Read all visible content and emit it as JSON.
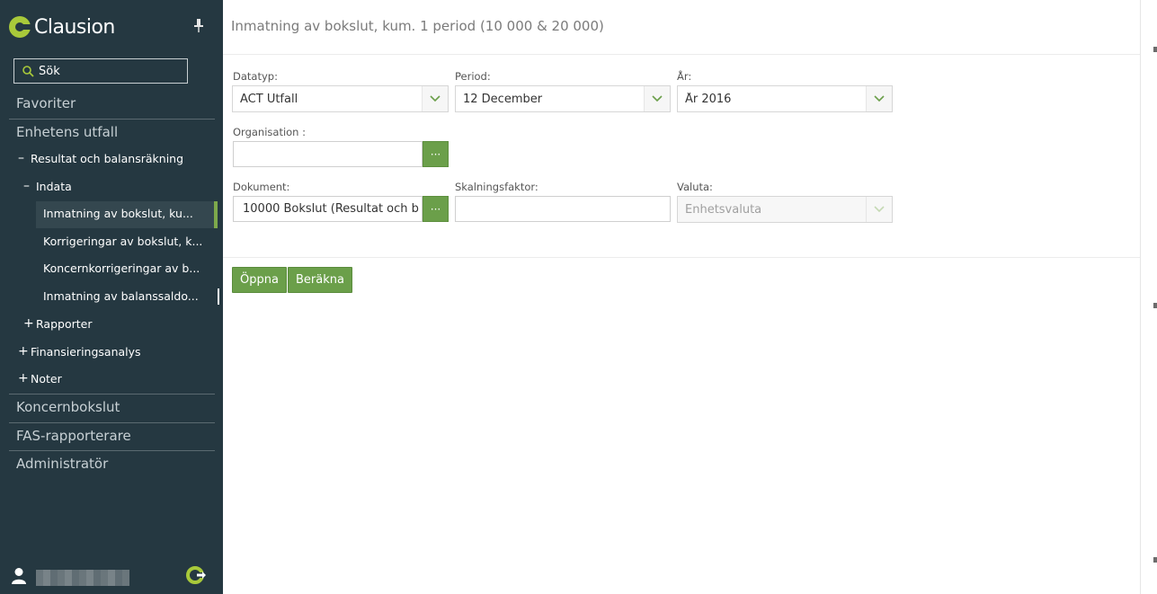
{
  "app": {
    "logo_text": "Clausion",
    "brand_color": "#a8c93a",
    "accent_color": "#6b9f4a"
  },
  "sidebar": {
    "search_placeholder": "Sök",
    "sections": {
      "favoriter": "Favoriter",
      "enhetens_utfall": "Enhetens utfall",
      "koncernbokslut": "Koncernbokslut",
      "fas_rapporterare": "FAS-rapporterare",
      "administrator": "Administratör"
    },
    "tree": {
      "resultat": {
        "sign": "–",
        "label": "Resultat och balansräkning"
      },
      "indata": {
        "sign": "–",
        "label": "Indata"
      },
      "leaves": [
        "Inmatning av bokslut, ku...",
        "Korrigeringar av bokslut, k...",
        "Koncernkorrigeringar av b...",
        "Inmatning av balanssaldo..."
      ],
      "rapporter": {
        "sign": "+",
        "label": "Rapporter"
      },
      "finansieringsanalys": {
        "sign": "+",
        "label": "Finansieringsanalys"
      },
      "noter": {
        "sign": "+",
        "label": "Noter"
      }
    }
  },
  "main": {
    "title": "Inmatning av bokslut, kum. 1 period (10 000 & 20 000)",
    "form": {
      "datatyp": {
        "label": "Datatyp:",
        "value": "ACT Utfall"
      },
      "period": {
        "label": "Period:",
        "value": "12 December"
      },
      "ar": {
        "label": "År:",
        "value": "År 2016"
      },
      "organisation": {
        "label": "Organisation :",
        "value": ""
      },
      "dokument": {
        "label": "Dokument:",
        "value": "10000 Bokslut (Resultat och b"
      },
      "skalningsfaktor": {
        "label": "Skalningsfaktor:",
        "value": ""
      },
      "valuta": {
        "label": "Valuta:",
        "value": "Enhetsvaluta"
      },
      "browse_label": "···"
    },
    "buttons": {
      "open": "Öppna",
      "calculate": "Beräkna"
    }
  }
}
